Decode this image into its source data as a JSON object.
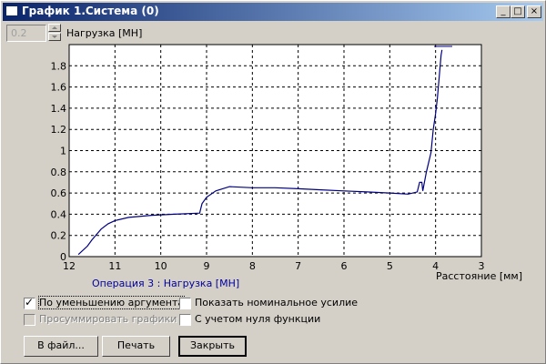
{
  "window": {
    "title": "График 1.Система (0)",
    "controls": [
      "_",
      "□",
      "×"
    ]
  },
  "spinner": {
    "value": "0.2"
  },
  "axes": {
    "ylabel": "Нагрузка [МН]",
    "xlabel": "Расстояние [мм]"
  },
  "caption": "Операция 3 : Нагрузка [МН]",
  "options": {
    "reduce_arg": {
      "label": "По уменьшению аргумента",
      "checked": true
    },
    "sum_graphs": {
      "label": "Просуммировать графики",
      "checked": false,
      "disabled": true
    },
    "show_nominal": {
      "label": "Показать номинальное усилие",
      "checked": false
    },
    "zero_func": {
      "label": "С учетом нуля функции",
      "checked": false
    }
  },
  "buttons": {
    "to_file": "В файл...",
    "print": "Печать",
    "close": "Закрыть"
  },
  "colors": {
    "series": "#000080",
    "caption": "#0000a0"
  },
  "chart_data": {
    "type": "line",
    "xlabel": "Расстояние [мм]",
    "ylabel": "Нагрузка [МН]",
    "xlim": [
      12,
      3
    ],
    "ylim": [
      0,
      2
    ],
    "x_ticks": [
      "12",
      "11",
      "10",
      "9",
      "8",
      "7",
      "6",
      "5",
      "4",
      "3"
    ],
    "y_ticks": [
      "0",
      "0.2",
      "0.4",
      "0.6",
      "0.8",
      "1",
      "1.2",
      "1.4",
      "1.6",
      "1.8"
    ],
    "grid": true,
    "series": [
      {
        "x": [
          11.8,
          11.6,
          11.5,
          11.3,
          11.15,
          11.0,
          10.7,
          10.2,
          9.7,
          9.15,
          9.1,
          9.0,
          8.8,
          8.5,
          8.0,
          7.5,
          7.0,
          6.5,
          6.0,
          5.5,
          5.0,
          4.6,
          4.4,
          4.35,
          4.3,
          4.28,
          4.2,
          4.1,
          4.05,
          4.0,
          3.96,
          3.92,
          3.88,
          3.86
        ],
        "y": [
          0.02,
          0.1,
          0.16,
          0.26,
          0.31,
          0.34,
          0.37,
          0.39,
          0.4,
          0.41,
          0.5,
          0.56,
          0.62,
          0.66,
          0.65,
          0.65,
          0.64,
          0.63,
          0.62,
          0.61,
          0.6,
          0.59,
          0.61,
          0.7,
          0.7,
          0.62,
          0.8,
          0.98,
          1.2,
          1.35,
          1.5,
          1.7,
          1.9,
          1.95
        ]
      }
    ]
  }
}
